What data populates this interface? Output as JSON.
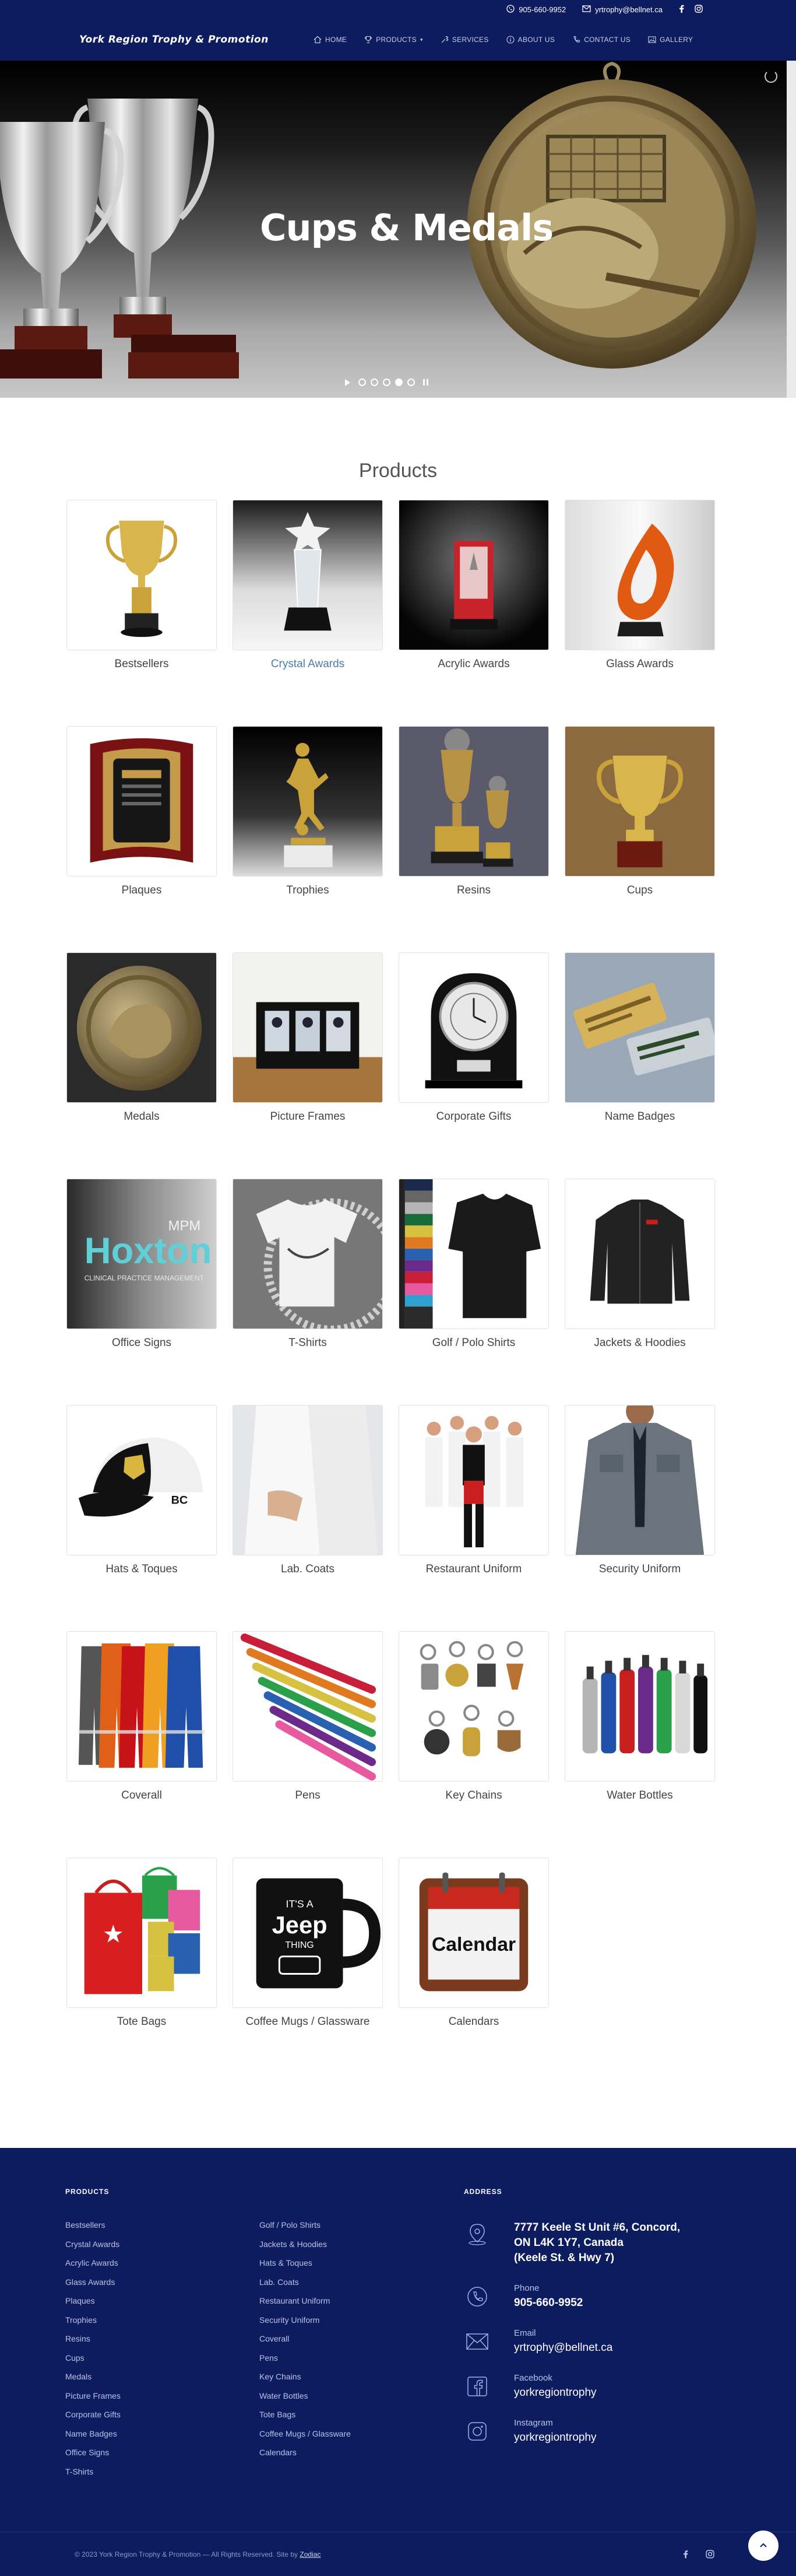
{
  "topbar": {
    "phone": "905-660-9952",
    "email": "yrtrophy@bellnet.ca"
  },
  "header": {
    "logo": "York Region Trophy & Promotion",
    "nav": [
      {
        "label": "HOME",
        "icon": "home-icon"
      },
      {
        "label": "PRODUCTS",
        "icon": "trophy-icon"
      },
      {
        "label": "SERVICES",
        "icon": "wrench-icon"
      },
      {
        "label": "ABOUT US",
        "icon": "info-icon"
      },
      {
        "label": "CONTACT US",
        "icon": "phone-icon"
      },
      {
        "label": "GALLERY",
        "icon": "image-icon"
      }
    ]
  },
  "hero": {
    "title": "Cups & Medals"
  },
  "products": {
    "title": "Products",
    "items": [
      "Bestsellers",
      "Crystal Awards",
      "Acrylic Awards",
      "Glass Awards",
      "Plaques",
      "Trophies",
      "Resins",
      "Cups",
      "Medals",
      "Picture Frames",
      "Corporate Gifts",
      "Name Badges",
      "Office Signs",
      "T-Shirts",
      "Golf / Polo Shirts",
      "Jackets & Hoodies",
      "Hats & Toques",
      "Lab. Coats",
      "Restaurant Uniform",
      "Security Uniform",
      "Coverall",
      "Pens",
      "Key Chains",
      "Water Bottles",
      "Tote Bags",
      "Coffee Mugs / Glassware",
      "Calendars"
    ],
    "thumb_text": {
      "office_sign_1": "Hoxton",
      "office_sign_2": "MPM",
      "office_sign_3": "CLINICAL PRACTICE MANAGEMENT",
      "mug_1": "IT'S A",
      "mug_2": "Jeep",
      "mug_3": "THING",
      "calendar": "Calendar"
    }
  },
  "footer": {
    "products_title": "PRODUCTS",
    "col1": [
      "Bestsellers",
      "Crystal Awards",
      "Acrylic Awards",
      "Glass Awards",
      "Plaques",
      "Trophies",
      "Resins",
      "Cups",
      "Medals",
      "Picture Frames",
      "Corporate Gifts",
      "Name Badges",
      "Office Signs",
      "T-Shirts"
    ],
    "col2": [
      "Golf / Polo Shirts",
      "Jackets & Hoodies",
      "Hats & Toques",
      "Lab. Coats",
      "Restaurant Uniform",
      "Security Uniform",
      "Coverall",
      "Pens",
      "Key Chains",
      "Water Bottles",
      "Tote Bags",
      "Coffee Mugs / Glassware",
      "Calendars"
    ],
    "address_title": "ADDRESS",
    "address": "7777 Keele St Unit #6, Concord, ON L4K 1Y7, Canada (Keele St. & Hwy 7)",
    "address_lines": [
      "7777 Keele St Unit #6, Concord,",
      "ON L4K 1Y7, Canada",
      "(Keele St. & Hwy 7)"
    ],
    "phone_label": "Phone",
    "phone": "905-660-9952",
    "email_label": "Email",
    "email": "yrtrophy@bellnet.ca",
    "facebook_label": "Facebook",
    "facebook": "yorkregiontrophy",
    "instagram_label": "Instagram",
    "instagram": "yorkregiontrophy",
    "copyright": "© 2023 York Region Trophy & Promotion — All Rights Reserved. Site by",
    "credit": "Zodiac"
  },
  "colors": {
    "navy": "#0d1c5e",
    "link": "#4a7bb0"
  }
}
